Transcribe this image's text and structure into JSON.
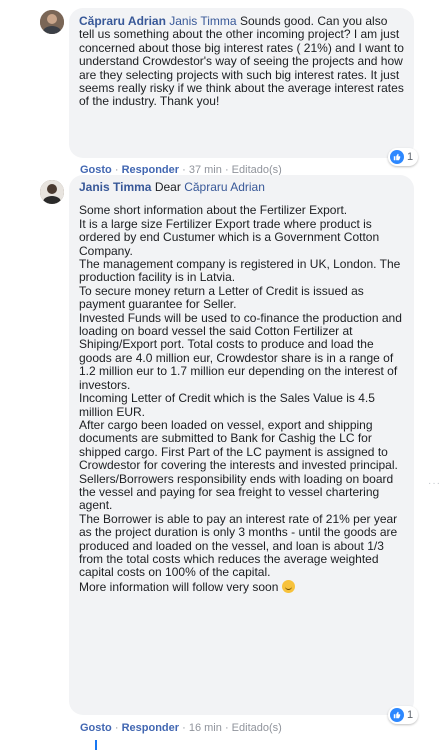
{
  "comment1": {
    "author": "Căpraru Adrian",
    "mention": "Janis Timma",
    "text": "Sounds good. Can you also tell us something about the other incoming project? I am just concerned about those big interest rates ( 21%) and I want to understand Crowdestor's way of seeing the projects and how are they selecting projects with such big interest rates. It just seems really risky if we think about the average interest rates of the industry. Thank you!",
    "actions": {
      "like": "Gosto",
      "reply": "Responder",
      "time": "37 min",
      "edited": "Editado(s)"
    },
    "reactions": {
      "type": "like-icon",
      "count": "1"
    }
  },
  "comment2": {
    "author": "Janis Timma",
    "mention_prefix": "Dear",
    "mention": "Căpraru Adrian",
    "paragraphs": [
      "Some short information about the Fertilizer Export.",
      "It is a large size Fertilizer Export trade where product is ordered by end Custumer which is a Government Cotton Company.",
      "The management company is registered in UK, London. The production facility is in Latvia.",
      "To secure money return a Letter of Credit is issued as payment guarantee for Seller.",
      "Invested Funds will be used to co-finance the production and loading on board vessel the said Cotton Fertilizer at Shiping/Export port. Total costs to produce and load the goods are 4.0 million eur, Crowdestor share is in a range of 1.2 million eur to 1.7 million eur depending on the interest of investors.",
      "Incoming Letter of Credit which is the Sales Value is 4.5 million EUR.",
      "After cargo been loaded on vessel, export and shipping documents are submitted to Bank for Cashig the LC for shipped cargo. First Part of the LC payment is assigned to Crowdestor for covering the interests and invested principal.",
      "Sellers/Borrowers responsibility ends with loading on board the vessel and paying for sea freight to vessel chartering agent.",
      "The Borrower is able to pay an interest rate of 21% per year as the project duration is only 3 months - until the goods are produced and loaded on the vessel, and loan is about 1/3 from the total costs which reduces the average weighted capital costs on 100% of the capital."
    ],
    "last_line": "More information will follow very soon",
    "emoji": "smile-emoji",
    "actions": {
      "like": "Gosto",
      "reply": "Responder",
      "time": "16 min",
      "edited": "Editado(s)"
    },
    "reactions": {
      "type": "like-icon",
      "count": "1"
    }
  },
  "colors": {
    "link": "#385898",
    "bubble": "#f2f3f5",
    "like": "#2d88ff"
  }
}
